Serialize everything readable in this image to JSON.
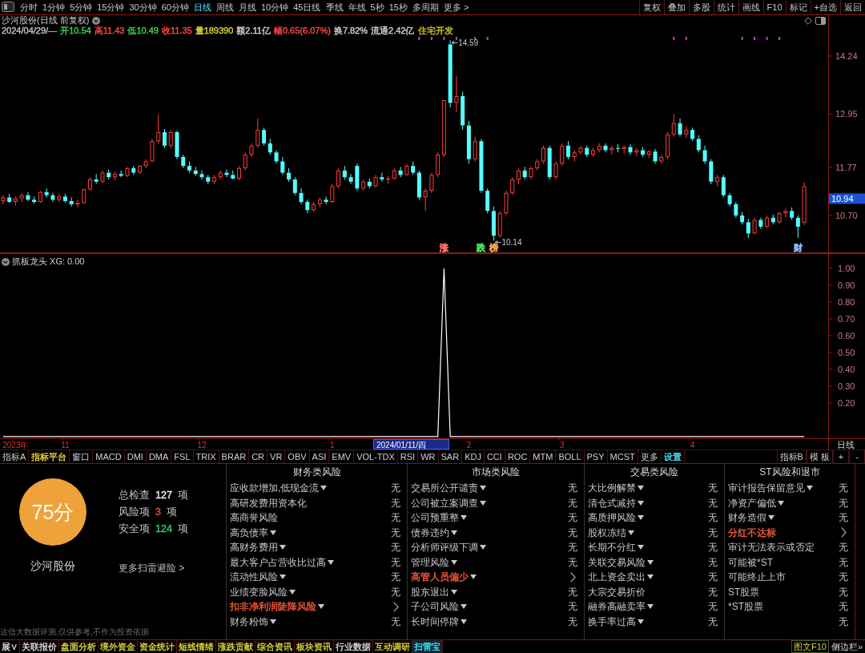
{
  "toolbar": {
    "periods": [
      {
        "label": "分时",
        "selected": false
      },
      {
        "label": "1分钟",
        "selected": false
      },
      {
        "label": "5分钟",
        "selected": false
      },
      {
        "label": "15分钟",
        "selected": false
      },
      {
        "label": "30分钟",
        "selected": false
      },
      {
        "label": "60分钟",
        "selected": false
      },
      {
        "label": "日线",
        "selected": true
      },
      {
        "label": "周线",
        "selected": false
      },
      {
        "label": "月线",
        "selected": false
      },
      {
        "label": "10分钟",
        "selected": false
      },
      {
        "label": "45日线",
        "selected": false
      },
      {
        "label": "季线",
        "selected": false
      },
      {
        "label": "年线",
        "selected": false
      },
      {
        "label": "5秒",
        "selected": false
      },
      {
        "label": "15秒",
        "selected": false
      },
      {
        "label": "多周期",
        "selected": false
      },
      {
        "label": "更多 >",
        "selected": false
      }
    ],
    "buttons": [
      "复权",
      "叠加",
      "多股",
      "统计",
      "画线",
      "F10",
      "标记",
      "+自选",
      "返回"
    ]
  },
  "chart_header": {
    "title": "沙河股份(日线 前复权)",
    "quote": [
      {
        "text": "2024/04/29/—",
        "color": "#c0c0c0"
      },
      {
        "text": "开10.54",
        "color": "#3ed24e"
      },
      {
        "text": "高11.43",
        "color": "#ff4848"
      },
      {
        "text": "低10.49",
        "color": "#3ed24e"
      },
      {
        "text": "收11.35",
        "color": "#ff4848"
      },
      {
        "text": "量189390",
        "color": "#d8cf3a"
      },
      {
        "text": "额2.11亿",
        "color": "#d0d0d0"
      },
      {
        "text": "幅0.65(6.07%)",
        "color": "#ff4848"
      },
      {
        "text": "换7.82%",
        "color": "#d0d0d0"
      },
      {
        "text": "流通2.42亿",
        "color": "#d0d0d0"
      },
      {
        "text": "住宅开发",
        "color": "#c9c22e"
      }
    ]
  },
  "chart": {
    "chart_data": [
      {
        "type": "candlestick",
        "ylim": [
          9.862,
          15.165
        ],
        "yticks": [
          {
            "value": 10.7,
            "label": "10.70"
          },
          {
            "value": 11.77,
            "label": "11.77"
          },
          {
            "value": 12.95,
            "label": "12.95"
          },
          {
            "value": 14.24,
            "label": "14.24"
          }
        ],
        "ohlc": [
          [
            11.02,
            11.15,
            10.95,
            11.1
          ],
          [
            11.1,
            11.18,
            10.98,
            11.0
          ],
          [
            11.0,
            11.12,
            10.92,
            11.08
          ],
          [
            11.08,
            11.2,
            11.0,
            11.15
          ],
          [
            11.15,
            11.22,
            11.02,
            11.05
          ],
          [
            11.05,
            11.12,
            10.96,
            11.0
          ],
          [
            11.0,
            11.25,
            10.98,
            11.22
          ],
          [
            11.22,
            11.3,
            11.1,
            11.15
          ],
          [
            11.15,
            11.2,
            11.0,
            11.05
          ],
          [
            11.05,
            11.18,
            11.0,
            11.12
          ],
          [
            11.12,
            11.18,
            10.98,
            11.02
          ],
          [
            11.02,
            11.1,
            10.9,
            10.95
          ],
          [
            10.95,
            11.05,
            10.88,
            10.98
          ],
          [
            10.98,
            11.3,
            10.95,
            11.28
          ],
          [
            11.28,
            11.55,
            11.25,
            11.5
          ],
          [
            11.5,
            11.62,
            11.4,
            11.45
          ],
          [
            11.45,
            11.7,
            11.42,
            11.65
          ],
          [
            11.65,
            11.72,
            11.5,
            11.55
          ],
          [
            11.55,
            11.68,
            11.48,
            11.62
          ],
          [
            11.62,
            11.7,
            11.55,
            11.58
          ],
          [
            11.58,
            11.78,
            11.55,
            11.75
          ],
          [
            11.75,
            11.8,
            11.6,
            11.65
          ],
          [
            11.65,
            11.82,
            11.62,
            11.8
          ],
          [
            11.8,
            11.95,
            11.75,
            11.9
          ],
          [
            11.9,
            12.4,
            11.88,
            12.35
          ],
          [
            12.35,
            12.95,
            12.3,
            12.55
          ],
          [
            12.55,
            12.62,
            12.2,
            12.25
          ],
          [
            12.25,
            12.6,
            12.2,
            12.55
          ],
          [
            12.55,
            12.58,
            11.95,
            12.0
          ],
          [
            12.0,
            12.05,
            11.75,
            11.8
          ],
          [
            11.8,
            11.9,
            11.65,
            11.7
          ],
          [
            11.7,
            11.78,
            11.58,
            11.62
          ],
          [
            11.62,
            11.7,
            11.5,
            11.55
          ],
          [
            11.55,
            11.6,
            11.4,
            11.45
          ],
          [
            11.45,
            11.6,
            11.4,
            11.55
          ],
          [
            11.55,
            11.7,
            11.5,
            11.65
          ],
          [
            11.65,
            11.72,
            11.55,
            11.6
          ],
          [
            11.6,
            11.7,
            11.5,
            11.52
          ],
          [
            11.52,
            11.8,
            11.48,
            11.75
          ],
          [
            11.75,
            12.1,
            11.7,
            12.05
          ],
          [
            12.05,
            12.3,
            12.0,
            12.25
          ],
          [
            12.25,
            12.85,
            12.2,
            12.6
          ],
          [
            12.6,
            12.65,
            12.25,
            12.3
          ],
          [
            12.3,
            12.4,
            12.05,
            12.1
          ],
          [
            12.1,
            12.15,
            11.85,
            11.9
          ],
          [
            11.9,
            12.0,
            11.6,
            11.65
          ],
          [
            11.65,
            11.75,
            11.45,
            11.5
          ],
          [
            11.5,
            11.55,
            11.15,
            11.2
          ],
          [
            11.2,
            11.3,
            10.95,
            11.0
          ],
          [
            11.0,
            11.05,
            10.75,
            10.82
          ],
          [
            10.82,
            11.0,
            10.78,
            10.95
          ],
          [
            10.95,
            11.1,
            10.88,
            11.05
          ],
          [
            11.05,
            11.12,
            10.95,
            11.0
          ],
          [
            11.0,
            11.4,
            10.98,
            11.35
          ],
          [
            11.35,
            11.75,
            11.3,
            11.7
          ],
          [
            11.7,
            11.8,
            11.5,
            11.55
          ],
          [
            11.55,
            11.62,
            11.4,
            11.45
          ],
          [
            11.8,
            11.85,
            11.25,
            11.3
          ],
          [
            11.3,
            11.5,
            11.25,
            11.45
          ],
          [
            11.45,
            11.52,
            11.3,
            11.35
          ],
          [
            11.35,
            11.6,
            11.32,
            11.55
          ],
          [
            11.55,
            11.65,
            11.45,
            11.5
          ],
          [
            11.5,
            11.58,
            11.4,
            11.52
          ],
          [
            11.52,
            11.75,
            11.5,
            11.7
          ],
          [
            11.7,
            11.78,
            11.55,
            11.6
          ],
          [
            11.6,
            11.85,
            11.58,
            11.8
          ],
          [
            11.8,
            11.9,
            11.6,
            11.65
          ],
          [
            11.65,
            11.7,
            11.05,
            11.1
          ],
          [
            11.1,
            11.3,
            10.8,
            11.25
          ],
          [
            11.25,
            11.65,
            11.2,
            11.6
          ],
          [
            11.6,
            12.1,
            11.55,
            12.05
          ],
          [
            12.05,
            13.26,
            12.0,
            13.26
          ],
          [
            14.5,
            14.59,
            13.1,
            13.2
          ],
          [
            13.2,
            13.8,
            13.0,
            13.35
          ],
          [
            13.35,
            13.45,
            12.6,
            12.7
          ],
          [
            12.7,
            12.8,
            11.85,
            11.95
          ],
          [
            11.95,
            12.45,
            11.9,
            12.35
          ],
          [
            12.35,
            12.4,
            11.2,
            11.25
          ],
          [
            11.25,
            11.3,
            10.75,
            10.8
          ],
          [
            10.8,
            10.9,
            10.14,
            10.25
          ],
          [
            10.25,
            10.8,
            10.2,
            10.75
          ],
          [
            10.75,
            11.25,
            10.7,
            11.2
          ],
          [
            11.2,
            11.55,
            11.15,
            11.5
          ],
          [
            11.5,
            11.75,
            11.4,
            11.7
          ],
          [
            11.7,
            11.78,
            11.5,
            11.55
          ],
          [
            11.55,
            11.8,
            11.5,
            11.75
          ],
          [
            11.75,
            11.95,
            11.7,
            11.9
          ],
          [
            11.9,
            12.25,
            11.85,
            12.2
          ],
          [
            12.2,
            12.25,
            11.5,
            11.55
          ],
          [
            11.55,
            11.9,
            11.5,
            11.85
          ],
          [
            11.85,
            12.3,
            11.8,
            12.25
          ],
          [
            12.25,
            12.35,
            11.95,
            12.0
          ],
          [
            12.0,
            12.15,
            11.9,
            12.1
          ],
          [
            12.1,
            12.25,
            12.05,
            12.2
          ],
          [
            12.2,
            12.25,
            12.0,
            12.05
          ],
          [
            12.05,
            12.2,
            12.0,
            12.15
          ],
          [
            12.15,
            12.3,
            12.1,
            12.25
          ],
          [
            12.25,
            12.3,
            12.1,
            12.15
          ],
          [
            12.15,
            12.25,
            12.05,
            12.2
          ],
          [
            12.2,
            12.28,
            12.1,
            12.18
          ],
          [
            12.18,
            12.25,
            12.08,
            12.22
          ],
          [
            12.22,
            12.28,
            12.05,
            12.1
          ],
          [
            12.1,
            12.2,
            12.02,
            12.15
          ],
          [
            12.15,
            12.22,
            12.0,
            12.05
          ],
          [
            12.05,
            12.15,
            11.98,
            12.12
          ],
          [
            12.12,
            12.18,
            11.85,
            11.9
          ],
          [
            11.9,
            12.05,
            11.85,
            12.0
          ],
          [
            12.0,
            12.55,
            11.95,
            12.5
          ],
          [
            12.5,
            12.95,
            12.45,
            12.75
          ],
          [
            12.75,
            12.85,
            12.45,
            12.5
          ],
          [
            12.5,
            12.68,
            12.42,
            12.6
          ],
          [
            12.6,
            12.65,
            12.35,
            12.4
          ],
          [
            12.4,
            12.48,
            12.1,
            12.15
          ],
          [
            12.15,
            12.25,
            11.85,
            11.9
          ],
          [
            11.9,
            11.95,
            11.4,
            11.45
          ],
          [
            11.45,
            11.6,
            11.35,
            11.55
          ],
          [
            11.55,
            11.6,
            11.1,
            11.15
          ],
          [
            11.15,
            11.2,
            10.9,
            10.95
          ],
          [
            10.95,
            11.0,
            10.65,
            10.7
          ],
          [
            10.7,
            10.78,
            10.5,
            10.55
          ],
          [
            10.55,
            10.62,
            10.2,
            10.3
          ],
          [
            10.3,
            10.65,
            10.28,
            10.6
          ],
          [
            10.6,
            10.65,
            10.4,
            10.45
          ],
          [
            10.45,
            10.7,
            10.42,
            10.65
          ],
          [
            10.65,
            10.72,
            10.5,
            10.55
          ],
          [
            10.55,
            10.78,
            10.52,
            10.75
          ],
          [
            10.75,
            10.85,
            10.65,
            10.8
          ],
          [
            10.8,
            10.88,
            10.6,
            10.65
          ],
          [
            10.65,
            10.7,
            10.2,
            10.45
          ],
          [
            10.54,
            11.43,
            10.49,
            11.35
          ]
        ],
        "annotations": [
          "14.59",
          "10.14"
        ]
      },
      {
        "type": "line",
        "title": "抓板龙头 XG: 0.00",
        "color": "#ffffff",
        "ylim": [
          -0.01,
          1.09
        ],
        "yticks": [
          {
            "value": 0.2,
            "label": "0.20"
          },
          {
            "value": 0.3,
            "label": "0.30"
          },
          {
            "value": 0.4,
            "label": "0.40"
          },
          {
            "value": 0.5,
            "label": "0.50"
          },
          {
            "value": 0.6,
            "label": "0.60"
          },
          {
            "value": 0.7,
            "label": "0.70"
          },
          {
            "value": 0.8,
            "label": "0.80"
          },
          {
            "value": 0.9,
            "label": "0.90"
          },
          {
            "value": 1.0,
            "label": "1.00"
          }
        ],
        "values": [
          0,
          0,
          0,
          0,
          0,
          0,
          0,
          0,
          0,
          0,
          0,
          0,
          0,
          0,
          0,
          0,
          0,
          0,
          0,
          0,
          0,
          0,
          0,
          0,
          0,
          0,
          0,
          0,
          0,
          0,
          0,
          0,
          0,
          0,
          0,
          0,
          0,
          0,
          0,
          0,
          0,
          0,
          0,
          0,
          0,
          0,
          0,
          0,
          0,
          0,
          0,
          0,
          0,
          0,
          0,
          0,
          0,
          0,
          0,
          0,
          0,
          0,
          0,
          0,
          0,
          0,
          0,
          0,
          0,
          0,
          0,
          1,
          0,
          0,
          0,
          0,
          0,
          0,
          0,
          0,
          0,
          0,
          0,
          0,
          0,
          0,
          0,
          0,
          0,
          0,
          0,
          0,
          0,
          0,
          0,
          0,
          0,
          0,
          0,
          0,
          0,
          0,
          0,
          0,
          0,
          0,
          0,
          0,
          0,
          0,
          0,
          0,
          0,
          0,
          0,
          0,
          0,
          0,
          0,
          0,
          0,
          0,
          0,
          0,
          0,
          0,
          0,
          0,
          0,
          0
        ],
        "categories": [
          null,
          null,
          "2023年",
          null,
          null,
          null,
          null,
          null,
          null,
          null,
          "11",
          null,
          null,
          null,
          null,
          null,
          null,
          null,
          null,
          null,
          null,
          null,
          null,
          null,
          null,
          null,
          null,
          null,
          null,
          null,
          null,
          null,
          "12",
          null,
          null,
          null,
          null,
          null,
          null,
          null,
          null,
          null,
          null,
          null,
          null,
          null,
          null,
          null,
          null,
          null,
          null,
          null,
          null,
          "1",
          null,
          null,
          null,
          null,
          null,
          null,
          null,
          null,
          null,
          null,
          null,
          null,
          null,
          null,
          null,
          null,
          null,
          null,
          null,
          null,
          null,
          "2",
          null,
          null,
          null,
          null,
          null,
          null,
          null,
          null,
          null,
          null,
          null,
          null,
          null,
          null,
          "3",
          null,
          null,
          null,
          null,
          null,
          null,
          null,
          null,
          null,
          null,
          null,
          null,
          null,
          null,
          null,
          null,
          null,
          null,
          null,
          null,
          "4",
          null,
          null,
          null,
          null,
          null,
          null,
          null,
          null,
          null,
          null,
          null,
          null,
          null,
          null,
          null,
          null,
          null,
          null
        ]
      }
    ],
    "event_tags": [
      {
        "text": "涨",
        "color": "#ff6a6a"
      },
      {
        "text": "跌",
        "color": "#4ee05a"
      },
      {
        "text": "榜",
        "color": "#f0a050"
      },
      {
        "text": "财",
        "color": "#8ab8ff"
      }
    ],
    "cursor_price": "10.94",
    "cursor_date": "2024/01/11/四",
    "period": "日线"
  },
  "indicator_tabs": {
    "left": [
      {
        "label": "指标A"
      },
      {
        "label": "指标平台",
        "color": "#e8d23c"
      },
      {
        "label": "窗口"
      },
      {
        "label": "MACD"
      },
      {
        "label": "DMI"
      },
      {
        "label": "DMA"
      },
      {
        "label": "FSL"
      },
      {
        "label": "TRIX"
      },
      {
        "label": "BRAR"
      },
      {
        "label": "CR"
      },
      {
        "label": "VR"
      },
      {
        "label": "OBV"
      },
      {
        "label": "ASI"
      },
      {
        "label": "EMV"
      },
      {
        "label": "VOL-TDX"
      },
      {
        "label": "RSI"
      },
      {
        "label": "WR"
      },
      {
        "label": "SAR"
      },
      {
        "label": "KDJ"
      },
      {
        "label": "CCI"
      },
      {
        "label": "ROC"
      },
      {
        "label": "MTM"
      },
      {
        "label": "BOLL"
      },
      {
        "label": "PSY"
      },
      {
        "label": "MCST"
      },
      {
        "label": "更多"
      },
      {
        "label": "设置",
        "color": "#3fe0e8"
      }
    ],
    "right": [
      "指标B",
      "模 板",
      "+",
      "-"
    ]
  },
  "risk_panel": {
    "score": "75分",
    "stock": "沙河股份",
    "stats": [
      {
        "label": "总检查",
        "value": "127",
        "unit": "项",
        "color": "#ececec"
      },
      {
        "label": "风险项",
        "value": "3",
        "unit": "项",
        "color": "#f04a36"
      },
      {
        "label": "安全项",
        "value": "124",
        "unit": "项",
        "color": "#2fc46e"
      }
    ],
    "more_link": "更多扫雷避险 >",
    "disclaimer": "达信大数据评测,仅供参考,不作为投资依据",
    "columns": [
      {
        "heading": "财务类风险",
        "items": [
          {
            "label": "应收款增加,低现金流",
            "dropdown": true,
            "flagged": false,
            "value": "无"
          },
          {
            "label": "高研发费用资本化",
            "dropdown": false,
            "flagged": false,
            "value": "无"
          },
          {
            "label": "高商誉风险",
            "dropdown": false,
            "flagged": false,
            "value": "无"
          },
          {
            "label": "高负债率",
            "dropdown": true,
            "flagged": false,
            "value": "无"
          },
          {
            "label": "高财务费用",
            "dropdown": true,
            "flagged": false,
            "value": "无"
          },
          {
            "label": "最大客户占营收比过高",
            "dropdown": true,
            "flagged": false,
            "value": "无"
          },
          {
            "label": "流动性风险",
            "dropdown": true,
            "flagged": false,
            "value": "无"
          },
          {
            "label": "业绩变脸风险",
            "dropdown": true,
            "flagged": false,
            "value": "无"
          },
          {
            "label": "扣非净利润陡降风险",
            "dropdown": true,
            "flagged": true
          },
          {
            "label": "财务粉饰",
            "dropdown": true,
            "flagged": false,
            "value": "无"
          }
        ]
      },
      {
        "heading": "市场类风险",
        "items": [
          {
            "label": "交易所公开谴责",
            "dropdown": true,
            "flagged": false,
            "value": "无"
          },
          {
            "label": "公司被立案调查",
            "dropdown": true,
            "flagged": false,
            "value": "无"
          },
          {
            "label": "公司预重整",
            "dropdown": true,
            "flagged": false,
            "value": "无"
          },
          {
            "label": "债券违约",
            "dropdown": true,
            "flagged": false,
            "value": "无"
          },
          {
            "label": "分析师评级下调",
            "dropdown": true,
            "flagged": false,
            "value": "无"
          },
          {
            "label": "管理风险",
            "dropdown": true,
            "flagged": false,
            "value": "无"
          },
          {
            "label": "高管人员偏少",
            "dropdown": true,
            "flagged": true
          },
          {
            "label": "股东退出",
            "dropdown": true,
            "flagged": false,
            "value": "无"
          },
          {
            "label": "子公司风险",
            "dropdown": true,
            "flagged": false,
            "value": "无"
          },
          {
            "label": "长时间停牌",
            "dropdown": true,
            "flagged": false,
            "value": "无"
          }
        ]
      },
      {
        "heading": "交易类风险",
        "items": [
          {
            "label": "大比例解禁",
            "dropdown": true,
            "flagged": false,
            "value": "无"
          },
          {
            "label": "清仓式减持",
            "dropdown": true,
            "flagged": false,
            "value": "无"
          },
          {
            "label": "高质押风险",
            "dropdown": true,
            "flagged": false,
            "value": "无"
          },
          {
            "label": "股权冻结",
            "dropdown": true,
            "flagged": false,
            "value": "无"
          },
          {
            "label": "长期不分红",
            "dropdown": true,
            "flagged": false,
            "value": "无"
          },
          {
            "label": "关联交易风险",
            "dropdown": true,
            "flagged": false,
            "value": "无"
          },
          {
            "label": "北上资金卖出",
            "dropdown": true,
            "flagged": false,
            "value": "无"
          },
          {
            "label": "大宗交易折价",
            "dropdown": false,
            "flagged": false,
            "value": "无"
          },
          {
            "label": "融券高融卖率",
            "dropdown": true,
            "flagged": false,
            "value": "无"
          },
          {
            "label": "换手率过高",
            "dropdown": true,
            "flagged": false,
            "value": "无"
          }
        ]
      },
      {
        "heading": "ST风险和退市",
        "items": [
          {
            "label": "审计报告保留意见",
            "dropdown": true,
            "flagged": false,
            "value": "无"
          },
          {
            "label": "净资产偏低",
            "dropdown": true,
            "flagged": false,
            "value": "无"
          },
          {
            "label": "财务造假",
            "dropdown": true,
            "flagged": false,
            "value": "无"
          },
          {
            "label": "分红不达标",
            "dropdown": false,
            "flagged": true
          },
          {
            "label": "审计无法表示或否定",
            "dropdown": false,
            "flagged": false,
            "value": "无"
          },
          {
            "label": "可能被*ST",
            "dropdown": false,
            "flagged": false,
            "value": "无"
          },
          {
            "label": "可能终止上市",
            "dropdown": false,
            "flagged": false,
            "value": "无"
          },
          {
            "label": "ST股票",
            "dropdown": false,
            "flagged": false,
            "value": "无"
          },
          {
            "label": "*ST股票",
            "dropdown": false,
            "flagged": false,
            "value": "无"
          },
          {
            "dropdown": false,
            "flagged": false,
            "value": "无"
          }
        ]
      }
    ]
  },
  "bottom_tabs": {
    "tabs": [
      {
        "label": "展∨",
        "selected": false,
        "color": "#d8d8d8"
      },
      {
        "label": "关联报价",
        "selected": false,
        "color": "#d8d8d8"
      },
      {
        "label": "盘面分析",
        "selected": false,
        "color": "#d8d23c"
      },
      {
        "label": "境外资金",
        "selected": false,
        "color": "#d8d23c"
      },
      {
        "label": "资金统计",
        "selected": false,
        "color": "#d8d23c"
      },
      {
        "label": "短线情绪",
        "selected": false,
        "color": "#d8d23c"
      },
      {
        "label": "涨跌贡献",
        "selected": false,
        "color": "#d8d23c"
      },
      {
        "label": "综合资讯",
        "selected": false,
        "color": "#d8d23c"
      },
      {
        "label": "板块资讯",
        "selected": false,
        "color": "#d8d23c"
      },
      {
        "label": "行业数据",
        "selected": false,
        "color": "#d8d8d8"
      },
      {
        "label": "互动调研",
        "selected": false,
        "color": "#d8d23c"
      },
      {
        "label": "扫雷宝",
        "selected": true
      }
    ],
    "right": [
      {
        "label": "图文F10",
        "kind": "boxed"
      },
      {
        "label": "侧边栏»",
        "kind": "plain"
      }
    ]
  }
}
